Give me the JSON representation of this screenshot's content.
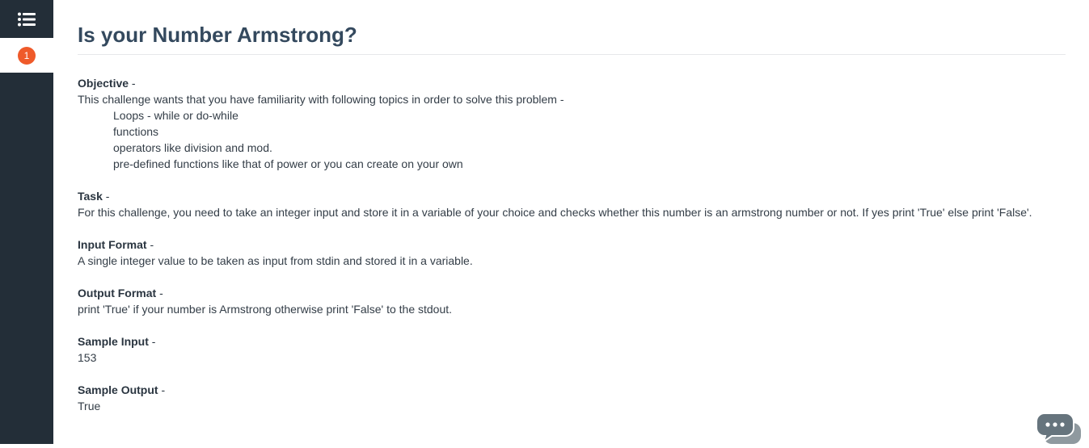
{
  "sidebar": {
    "menu_icon": "list-icon",
    "question_number": "1",
    "badge_color": "#ef5a2a",
    "background": "#232e38"
  },
  "problem": {
    "title": "Is your Number Armstrong?",
    "objective": {
      "heading": "Objective",
      "intro": "This challenge wants that you have familiarity with following topics in order to solve this problem -",
      "topics": [
        "Loops - while or do-while",
        "functions",
        "operators like division and mod.",
        "pre-defined functions like that of power or you can create on your own"
      ]
    },
    "task": {
      "heading": "Task",
      "text": "For this challenge, you need to take an integer input and store it in a variable of your choice and checks whether this number is an armstrong number or not. If yes print 'True' else print 'False'."
    },
    "input_format": {
      "heading": "Input Format",
      "text": "A single integer value to be taken as input from stdin and stored it in a variable."
    },
    "output_format": {
      "heading": "Output Format",
      "text": "print 'True' if your number is Armstrong otherwise print 'False' to the stdout."
    },
    "sample_input": {
      "heading": "Sample Input",
      "text": "153"
    },
    "sample_output": {
      "heading": "Sample Output",
      "text": "True"
    }
  },
  "chat": {
    "icon": "chat-bubbles-icon"
  }
}
